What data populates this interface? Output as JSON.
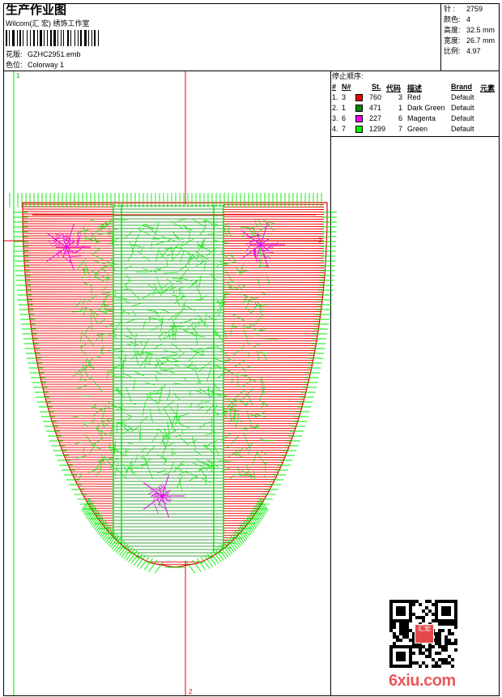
{
  "header": {
    "title": "生产作业图",
    "studio": "Wilcom(汇 宏) 绣饰工作室",
    "design_label": "花版:",
    "design_value": "GZHC2951.emb",
    "colorway_label": "色位:",
    "colorway_value": "Colorway 1"
  },
  "stats": {
    "stitches_label": "针 :",
    "stitches_value": "2759",
    "colors_label": "颜色:",
    "colors_value": "4",
    "height_label": "高度:",
    "height_value": "32.5 mm",
    "width_label": "宽度:",
    "width_value": "26.7 mm",
    "scale_label": "比例:",
    "scale_value": "4.97"
  },
  "stop_sequence": {
    "title": "停止顺序:",
    "headers": {
      "num": "#",
      "n": "N#",
      "st": "St.",
      "code": "代码",
      "desc": "描述",
      "brand": "Brand",
      "element": "元素"
    },
    "rows": [
      {
        "num": "1.",
        "n": "3",
        "color": "#ee0000",
        "st": "760",
        "code": "3",
        "desc": "Red",
        "brand": "Default"
      },
      {
        "num": "2.",
        "n": "1",
        "color": "#008800",
        "st": "471",
        "code": "1",
        "desc": "Dark Green",
        "brand": "Default"
      },
      {
        "num": "3.",
        "n": "6",
        "color": "#ee00ee",
        "st": "227",
        "code": "6",
        "desc": "Magenta",
        "brand": "Default"
      },
      {
        "num": "4.",
        "n": "7",
        "color": "#00ee00",
        "st": "1299",
        "code": "7",
        "desc": "Green",
        "brand": "Default"
      }
    ]
  },
  "canvas": {
    "guide_top_label": "1",
    "guide_right_label": "2",
    "guide_bottom_label": "2",
    "design_colors": {
      "red": "#ee0000",
      "dark_green": "#008800",
      "magenta": "#ee00ee",
      "green": "#00ee00"
    }
  },
  "watermark": "6xiu.com",
  "seal_text": "汇宏"
}
